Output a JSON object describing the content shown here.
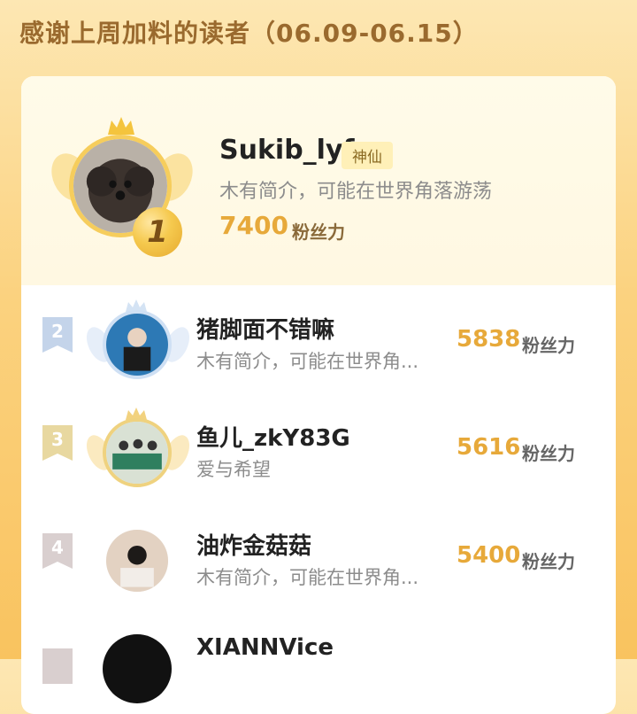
{
  "header": {
    "title": "感谢上周加料的读者（06.09-06.15）"
  },
  "top_fan": {
    "rank": "1",
    "name": "Sukib_lyf",
    "badge": "神仙",
    "bio": "木有简介，可能在世界角落游荡",
    "score": "7400",
    "unit": "粉丝力"
  },
  "fans": [
    {
      "rank": "2",
      "name": "猪脚面不错嘛",
      "bio": "木有简介，可能在世界角...",
      "score": "5838",
      "unit": "粉丝力"
    },
    {
      "rank": "3",
      "name": "鱼儿_zkY83G",
      "bio": "爱与希望",
      "score": "5616",
      "unit": "粉丝力"
    },
    {
      "rank": "4",
      "name": "油炸金菇菇",
      "bio": "木有简介，可能在世界角...",
      "score": "5400",
      "unit": "粉丝力"
    }
  ],
  "partial_fan": {
    "name": "XIANNVice"
  },
  "icons": [
    "crown-icon",
    "wing-icon",
    "rank-badge-icon"
  ],
  "colors": {
    "accent": "#e7a93a",
    "title": "#9a6a2e",
    "badge_bg": "#fff0b8"
  }
}
